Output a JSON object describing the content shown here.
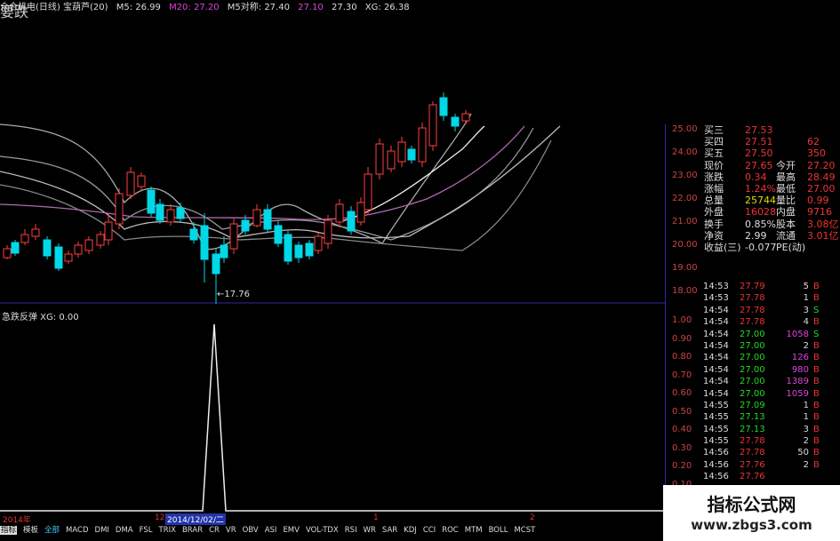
{
  "topbar": {
    "title": "众合机电(日线) 宝葫芦(20)",
    "m5": "M5: 26.99",
    "m20": "M20: 27.20",
    "m5dui": "M5对称: 27.40",
    "v1": "27.10",
    "v2": "27.30",
    "xg": "XG: 26.38"
  },
  "main_y_ticks": [
    "25.00",
    "24.00",
    "23.00",
    "22.00",
    "21.00",
    "20.00",
    "19.00",
    "18.00"
  ],
  "annot_low": "←17.76",
  "annot_down": "要跌",
  "indicator": {
    "header": "急跌反弹 XG: 0.00",
    "y_ticks": [
      "1.00",
      "0.90",
      "0.80",
      "0.70",
      "0.60",
      "0.50",
      "0.40",
      "0.30",
      "0.20",
      "0.10"
    ]
  },
  "time_axis": {
    "year": "2014年",
    "m12": "12",
    "date": "2014/12/02/二",
    "m1": "1",
    "m2": "2"
  },
  "tabs": [
    "指标",
    "模板",
    "全部",
    "MACD",
    "DMI",
    "DMA",
    "FSL",
    "TRIX",
    "BRAR",
    "CR",
    "VR",
    "OBV",
    "ASI",
    "EMV",
    "VOL-TDX",
    "RSI",
    "WR",
    "SAR",
    "KDJ",
    "CCI",
    "ROC",
    "MTM",
    "BOLL",
    "MCST"
  ],
  "quote": [
    {
      "k": "买三",
      "v": "27.53",
      "k2": "",
      "v2": "",
      "vc": "#e33"
    },
    {
      "k": "买四",
      "v": "27.51",
      "k2": "",
      "v2": "62",
      "vc": "#e33"
    },
    {
      "k": "买五",
      "v": "27.50",
      "k2": "",
      "v2": "350",
      "vc": "#e33"
    },
    {
      "k": "现价",
      "v": "27.65",
      "k2": "今开",
      "v2": "27.20",
      "vc": "#e33"
    },
    {
      "k": "涨跌",
      "v": "0.34",
      "k2": "最高",
      "v2": "28.49",
      "vc": "#e33"
    },
    {
      "k": "涨幅",
      "v": "1.24%",
      "k2": "最低",
      "v2": "27.00",
      "vc": "#e33"
    },
    {
      "k": "总量",
      "v": "25744",
      "k2": "量比",
      "v2": "0.99",
      "vc": "#dd0"
    },
    {
      "k": "外盘",
      "v": "16028",
      "k2": "内盘",
      "v2": "9716",
      "vc": "#e33"
    },
    {
      "k": "换手",
      "v": "0.85%",
      "k2": "股本",
      "v2": "3.08亿",
      "vc": "#ddd"
    },
    {
      "k": "净资",
      "v": "2.99",
      "k2": "流通",
      "v2": "3.01亿",
      "vc": "#ddd"
    },
    {
      "k": "收益(三)",
      "v": "-0.077",
      "k2": "PE(动)",
      "v2": "",
      "vc": "#ddd"
    }
  ],
  "trades": [
    {
      "t": "14:53",
      "p": "27.79",
      "q": "5",
      "s": "B"
    },
    {
      "t": "14:53",
      "p": "27.78",
      "q": "1",
      "s": "B"
    },
    {
      "t": "14:54",
      "p": "27.78",
      "q": "3",
      "s": "S"
    },
    {
      "t": "14:54",
      "p": "27.78",
      "q": "4",
      "s": "B"
    },
    {
      "t": "14:54",
      "p": "27.00",
      "q": "1058",
      "s": "S"
    },
    {
      "t": "14:54",
      "p": "27.00",
      "q": "2",
      "s": "B"
    },
    {
      "t": "14:54",
      "p": "27.00",
      "q": "126",
      "s": "B"
    },
    {
      "t": "14:54",
      "p": "27.00",
      "q": "980",
      "s": "B"
    },
    {
      "t": "14:54",
      "p": "27.00",
      "q": "1389",
      "s": "B"
    },
    {
      "t": "14:54",
      "p": "27.00",
      "q": "1059",
      "s": "B"
    },
    {
      "t": "14:55",
      "p": "27.09",
      "q": "1",
      "s": "B"
    },
    {
      "t": "14:55",
      "p": "27.13",
      "q": "1",
      "s": "B"
    },
    {
      "t": "14:55",
      "p": "27.13",
      "q": "3",
      "s": "B"
    },
    {
      "t": "14:55",
      "p": "27.78",
      "q": "2",
      "s": "B"
    },
    {
      "t": "14:56",
      "p": "27.78",
      "q": "50",
      "s": "B"
    },
    {
      "t": "14:56",
      "p": "27.76",
      "q": "2",
      "s": "B"
    },
    {
      "t": "14:56",
      "p": "27.76",
      "q": "",
      "s": ""
    }
  ],
  "watermark": {
    "title": "指标公式网",
    "url": "www.zbgs3.com"
  },
  "colors": {
    "up": "#ff4040",
    "down": "#00d8e8",
    "accent": "#2a2aa0"
  }
}
